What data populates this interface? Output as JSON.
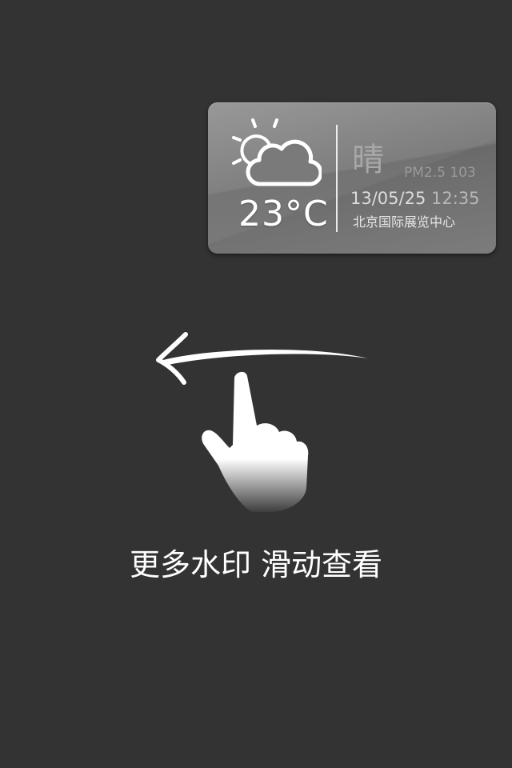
{
  "widget": {
    "icon": "partly-cloudy-sun-icon",
    "temperature": "23°C",
    "condition": "晴",
    "pm_label": "PM2.5 103",
    "date": "13/05/25",
    "time": "12:35",
    "location": "北京国际展览中心"
  },
  "hint": {
    "arrow_icon": "swipe-left-arrow-icon",
    "hand_icon": "pointing-hand-icon",
    "text": "更多水印 滑动查看"
  }
}
